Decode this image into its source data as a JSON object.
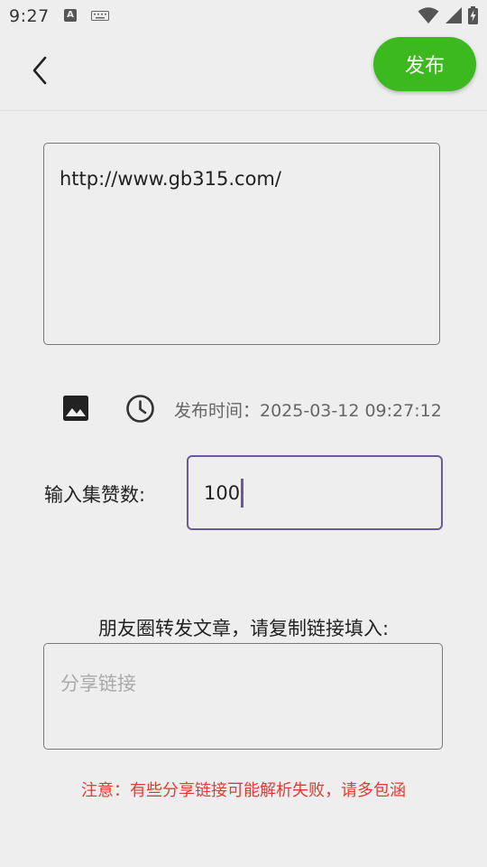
{
  "status_bar": {
    "time": "9:27",
    "notification_letter": "A"
  },
  "header": {
    "publish_label": "发布"
  },
  "content": {
    "text": "http://www.gb315.com/"
  },
  "tools": {
    "publish_time": "发布时间：2025-03-12 09:27:12"
  },
  "likes": {
    "label": "输入集赞数:",
    "value": "100"
  },
  "share": {
    "title": "朋友圈转发文章，请复制链接填入:",
    "placeholder": "分享链接"
  },
  "notice": "注意：有些分享链接可能解析失败，请多包涵",
  "colors": {
    "accent_green": "#3cb91f",
    "focus_purple": "#6b5a95",
    "warning_red": "#e53935"
  }
}
